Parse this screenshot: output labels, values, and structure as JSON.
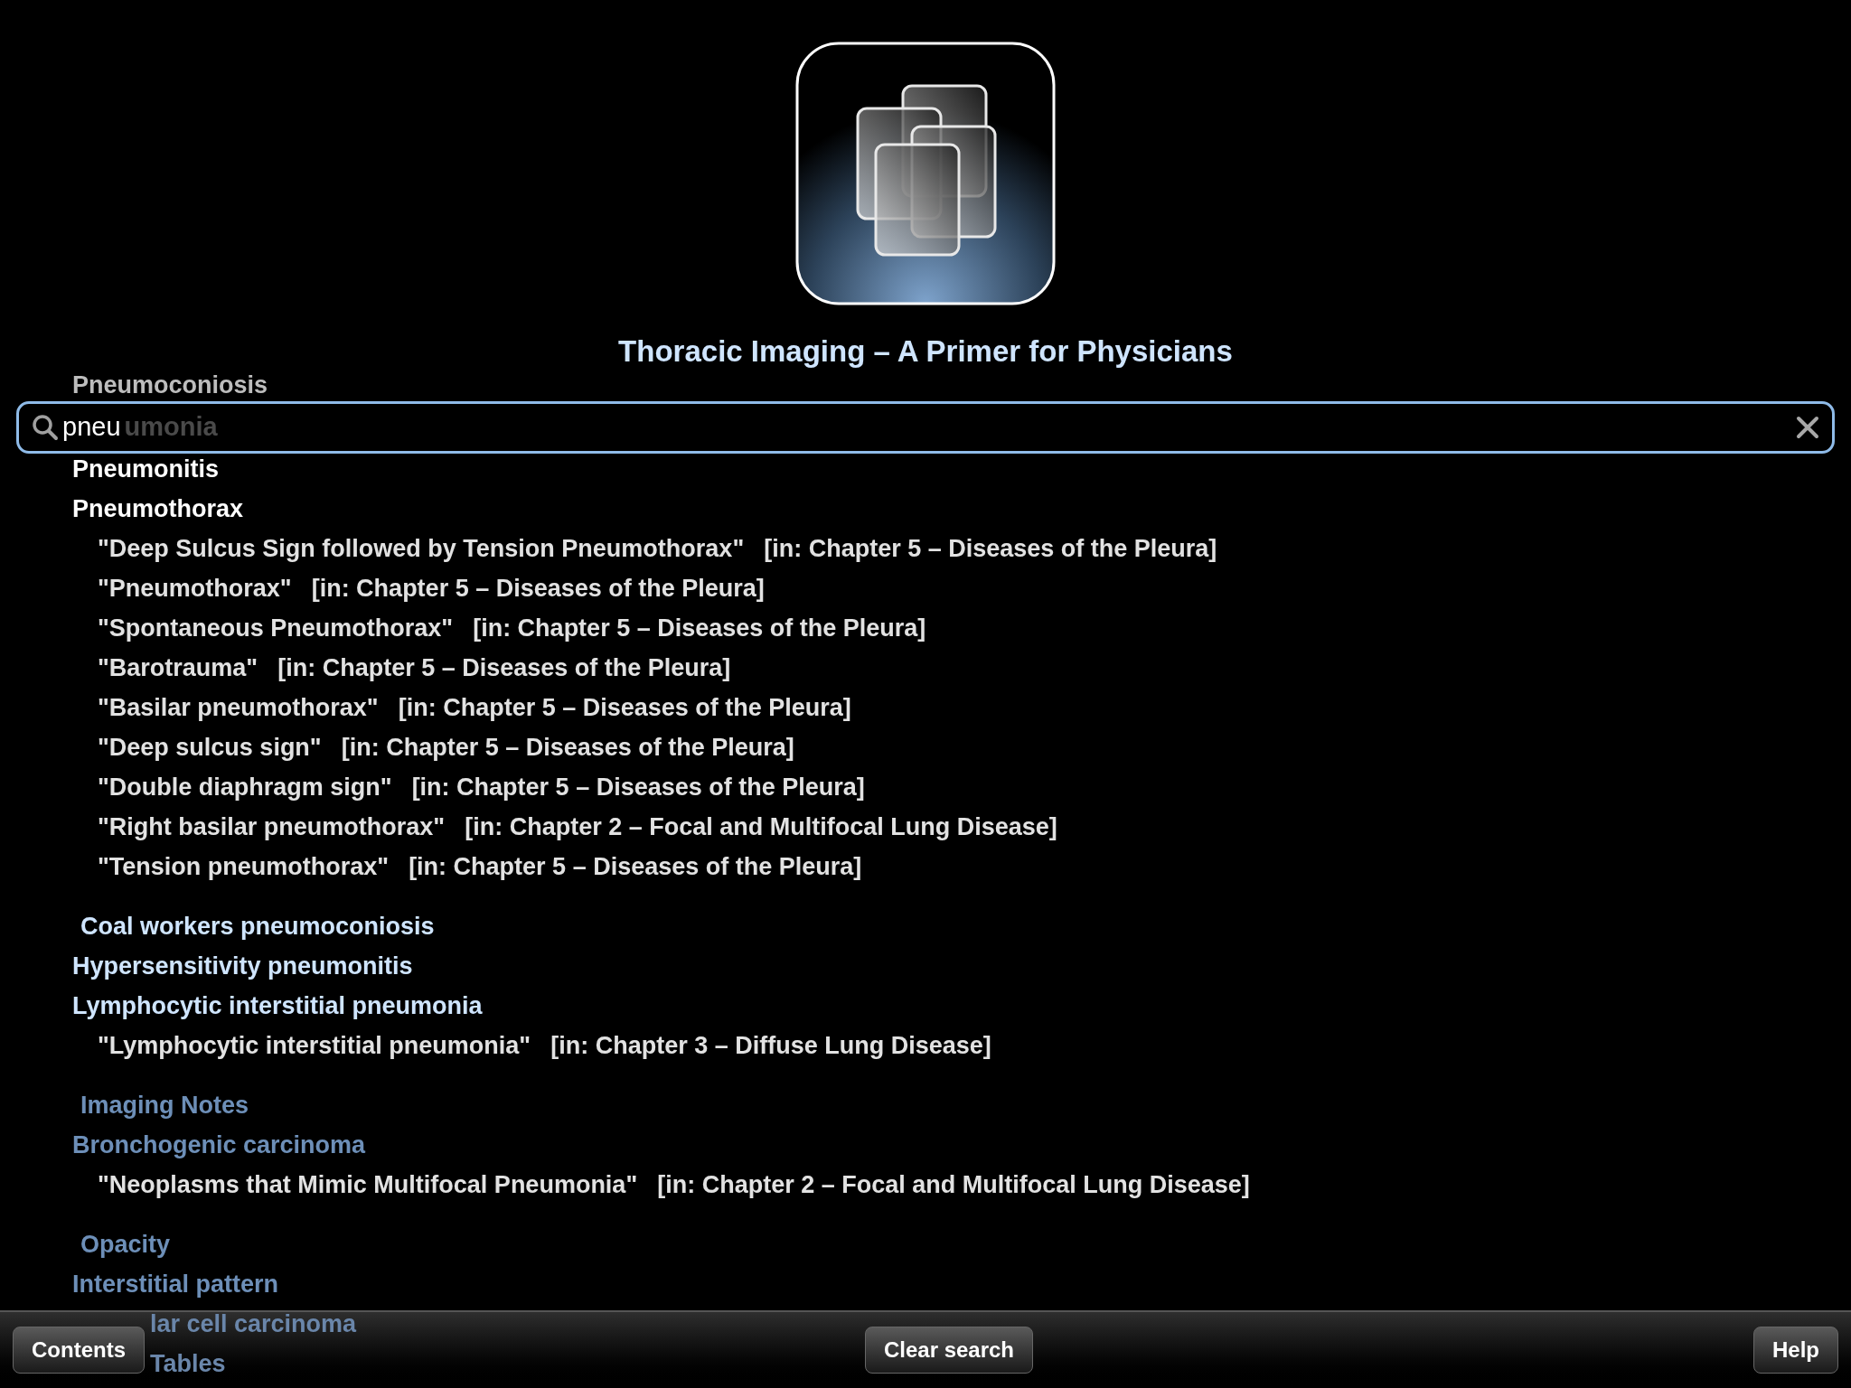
{
  "title": "Thoracic Imaging – A Primer for Physicians",
  "above_field": "Pneumoconiosis",
  "search": {
    "value": "pneu",
    "behind_text": "umonia"
  },
  "groups": [
    {
      "color": "#ffffff",
      "terms": [
        {
          "label": "Pneumonitis"
        },
        {
          "label": "Pneumothorax",
          "hits": [
            {
              "quote": "\"Deep Sulcus Sign followed by Tension Pneumothorax\"",
              "location": "[in: Chapter 5 – Diseases of the Pleura]"
            },
            {
              "quote": "\"Pneumothorax\"",
              "location": "[in: Chapter 5 – Diseases of the Pleura]"
            },
            {
              "quote": "\"Spontaneous Pneumothorax\"",
              "location": "[in: Chapter 5 – Diseases of the Pleura]"
            },
            {
              "quote": "\"Barotrauma\"",
              "location": "[in: Chapter 5 – Diseases of the Pleura]"
            },
            {
              "quote": "\"Basilar pneumothorax\"",
              "location": "[in: Chapter 5 – Diseases of the Pleura]"
            },
            {
              "quote": "\"Deep sulcus sign\"",
              "location": "[in: Chapter 5 – Diseases of the Pleura]"
            },
            {
              "quote": "\"Double diaphragm sign\"",
              "location": "[in: Chapter 5 – Diseases of the Pleura]"
            },
            {
              "quote": "\"Right basilar pneumothorax\"",
              "location": "[in: Chapter 2 – Focal and Multifocal Lung Disease]"
            },
            {
              "quote": "\"Tension pneumothorax\"",
              "location": "[in: Chapter 5 – Diseases of the Pleura]"
            }
          ]
        }
      ]
    },
    {
      "color": "#cfe5ff",
      "heading": "Coal workers pneumoconiosis",
      "terms": [
        {
          "label": "Hypersensitivity pneumonitis"
        },
        {
          "label": "Lymphocytic interstitial pneumonia",
          "hits": [
            {
              "quote": "\"Lymphocytic interstitial pneumonia\"",
              "location": "[in: Chapter 3 – Diffuse Lung Disease]"
            }
          ]
        }
      ]
    },
    {
      "color": "#6d8fb8",
      "heading": "Imaging Notes",
      "terms": [
        {
          "label": "Bronchogenic carcinoma",
          "hits": [
            {
              "quote": "\"Neoplasms that Mimic Multifocal Pneumonia\"",
              "location": "[in: Chapter 2 – Focal and Multifocal Lung Disease]"
            }
          ]
        }
      ]
    },
    {
      "color": "#6d8fb8",
      "heading": "Opacity",
      "terms": [
        {
          "label": "Interstitial pattern"
        },
        {
          "label": "lar cell carcinoma",
          "kind": "partial"
        },
        {
          "label": "Tables",
          "kind": "partial"
        }
      ]
    }
  ],
  "toolbar": {
    "left": "Contents",
    "center": "Clear search",
    "right": "Help"
  }
}
